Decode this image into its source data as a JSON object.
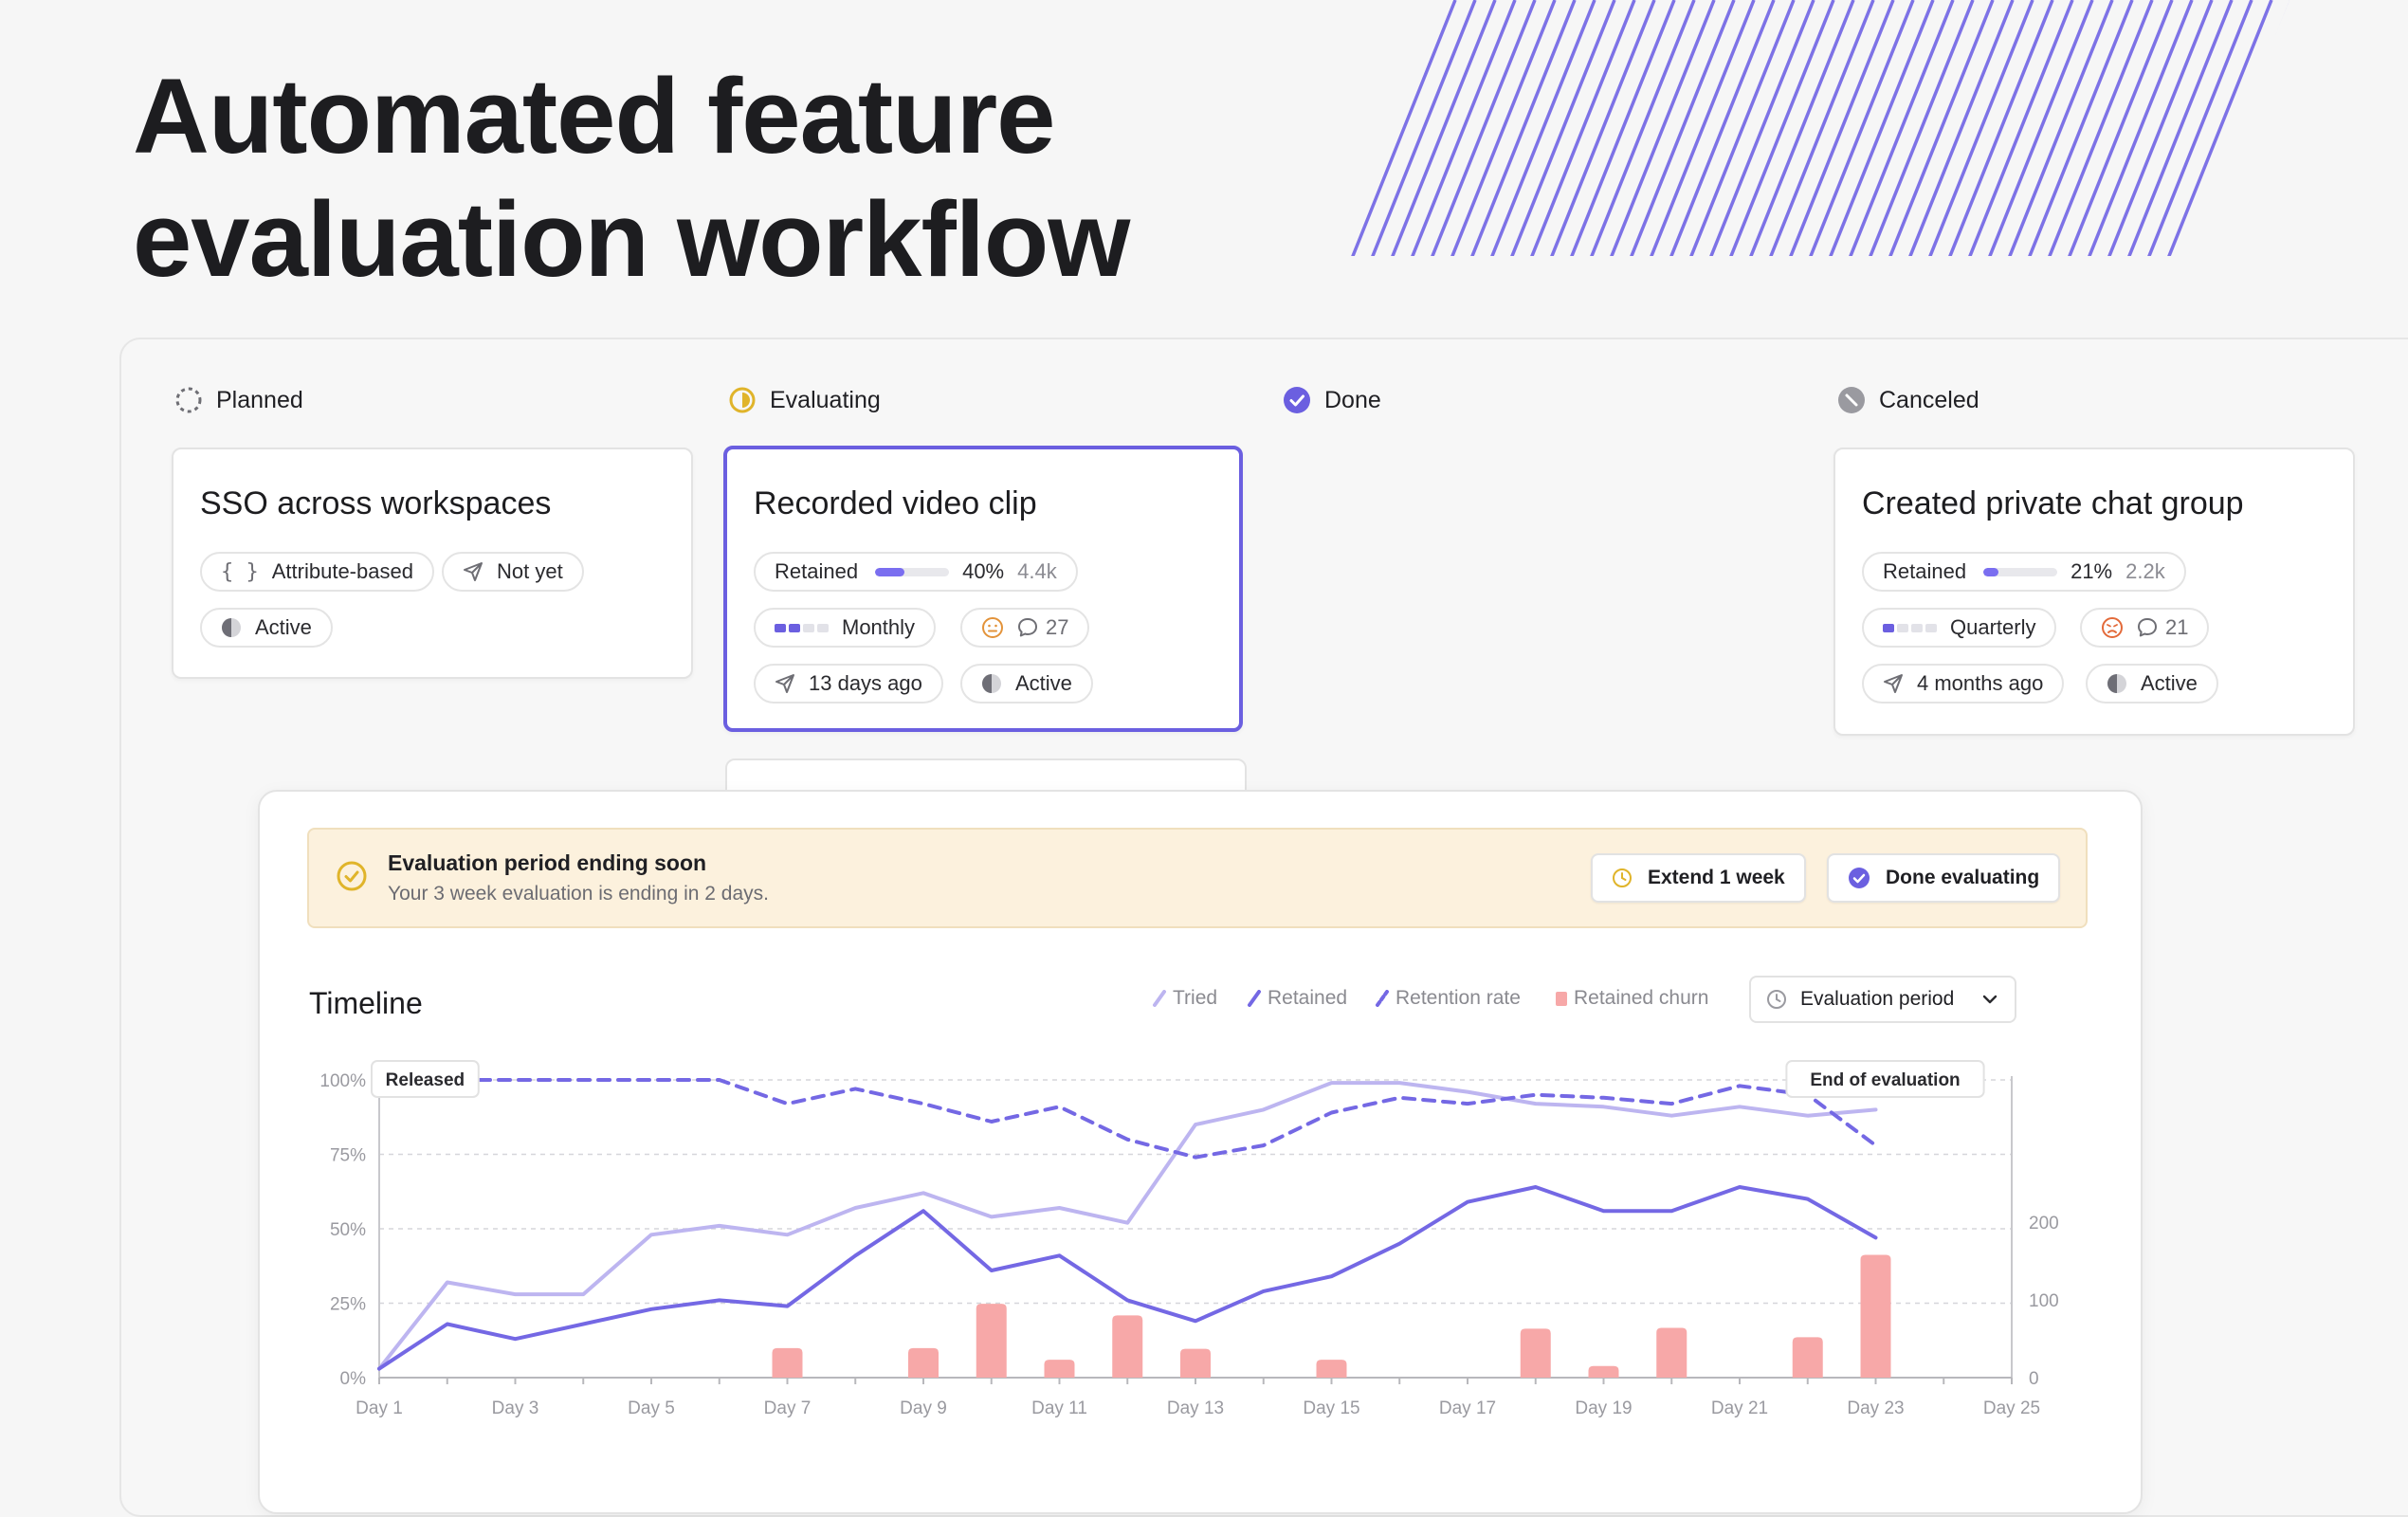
{
  "hero": {
    "line1": "Automated feature",
    "line2": "evaluation workflow"
  },
  "columns": [
    {
      "label": "Planned",
      "icon": "dashed-circle-icon"
    },
    {
      "label": "Evaluating",
      "icon": "half-circle-icon"
    },
    {
      "label": "Done",
      "icon": "check-circle-icon"
    },
    {
      "label": "Canceled",
      "icon": "canceled-circle-icon"
    }
  ],
  "cards": {
    "sso": {
      "title": "SSO across workspaces",
      "targeting": "Attribute-based",
      "released": "Not yet",
      "status": "Active"
    },
    "video": {
      "title": "Recorded video clip",
      "retained_label": "Retained",
      "retained_fraction": 0.4,
      "retained_pct": "40%",
      "retained_count": "4.4k",
      "frequency": "Monthly",
      "frequency_level": 2,
      "comments": "27",
      "released": "13 days ago",
      "status": "Active"
    },
    "chat": {
      "title": "Created private chat group",
      "retained_label": "Retained",
      "retained_fraction": 0.21,
      "retained_pct": "21%",
      "retained_count": "2.2k",
      "frequency": "Quarterly",
      "frequency_level": 1,
      "comments": "21",
      "released": "4 months ago",
      "status": "Active"
    }
  },
  "banner": {
    "title": "Evaluation period ending soon",
    "subtitle": "Your 3 week evaluation is ending in 2 days.",
    "extend_label": "Extend 1 week",
    "done_label": "Done evaluating"
  },
  "timeline": {
    "title": "Timeline",
    "legend": [
      "Tried",
      "Retained",
      "Retention rate",
      "Retained churn"
    ],
    "period_select": "Evaluation period"
  },
  "colors": {
    "accent": "#6b5fe0",
    "tried": "#bdb5f0",
    "retained": "#7468e4",
    "churn": "#f7a8a8",
    "banner_bg": "#fcf1dd"
  },
  "chart_data": {
    "type": "line",
    "x": [
      1,
      2,
      3,
      4,
      5,
      6,
      7,
      8,
      9,
      10,
      11,
      12,
      13,
      14,
      15,
      16,
      17,
      18,
      19,
      20,
      21,
      22,
      23
    ],
    "x_ticks": [
      "Day 1",
      "Day 3",
      "Day 5",
      "Day 7",
      "Day 9",
      "Day 11",
      "Day 13",
      "Day 15",
      "Day 17",
      "Day 19",
      "Day 21",
      "Day 23",
      "Day 25"
    ],
    "xlim": [
      1,
      25
    ],
    "y_ticks": [
      "0%",
      "25%",
      "50%",
      "75%",
      "100%"
    ],
    "ylim": [
      0,
      100
    ],
    "y2_ticks": [
      "0",
      "100",
      "200"
    ],
    "y2lim": [
      0,
      383
    ],
    "grid": true,
    "series": [
      {
        "name": "Tried",
        "axis": "left",
        "values": [
          3,
          32,
          28,
          28,
          48,
          51,
          48,
          57,
          62,
          54,
          57,
          52,
          85,
          90,
          99,
          99,
          96,
          92,
          91,
          88,
          91,
          88,
          90
        ]
      },
      {
        "name": "Retained",
        "axis": "left",
        "values": [
          3,
          18,
          13,
          18,
          23,
          26,
          24,
          41,
          56,
          36,
          41,
          26,
          19,
          29,
          34,
          45,
          59,
          64,
          56,
          56,
          64,
          60,
          47
        ]
      },
      {
        "name": "Retention rate",
        "axis": "left",
        "dashed": true,
        "values": [
          100,
          100,
          100,
          100,
          100,
          100,
          92,
          97,
          92,
          86,
          91,
          80,
          74,
          78,
          89,
          94,
          92,
          95,
          94,
          92,
          98,
          95,
          78
        ]
      },
      {
        "name": "Retained churn",
        "type": "bar",
        "axis": "right",
        "x": [
          7,
          9,
          10,
          11,
          12,
          13,
          15,
          18,
          19,
          20,
          22,
          23
        ],
        "values": [
          38,
          38,
          95,
          23,
          80,
          37,
          23,
          63,
          15,
          64,
          52,
          158
        ]
      }
    ],
    "annotations": [
      {
        "label": "Released",
        "x": 1
      },
      {
        "label": "End of evaluation",
        "x": 23
      }
    ]
  }
}
